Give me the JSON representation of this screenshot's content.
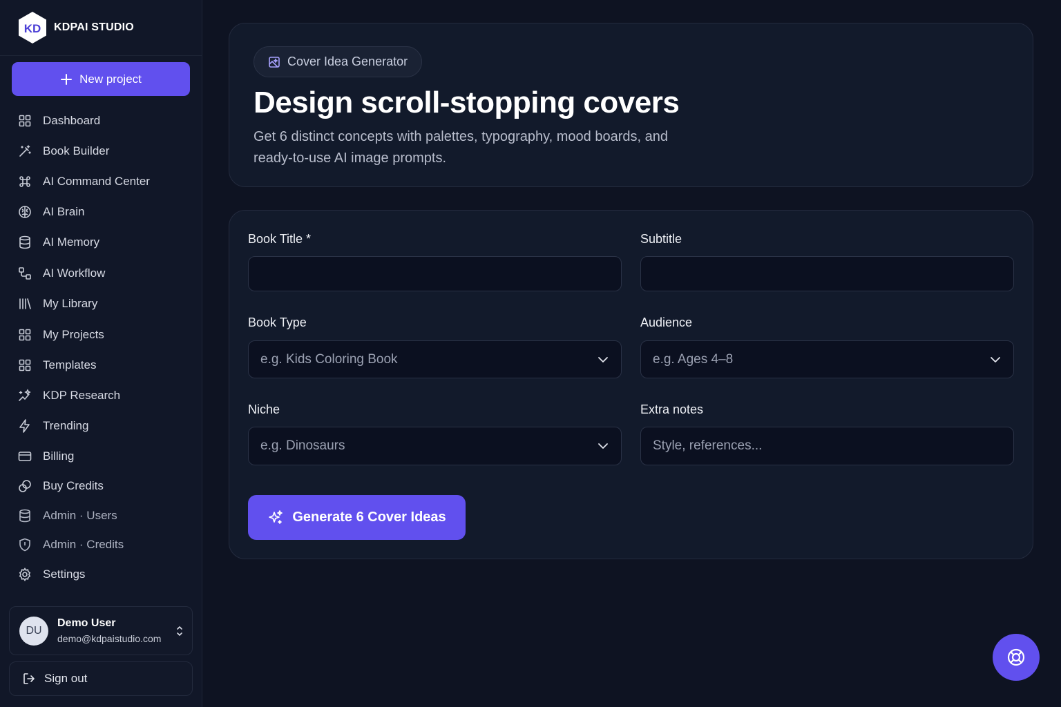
{
  "brand": {
    "name": "KDPAI STUDIO",
    "logo_text": "KD"
  },
  "sidebar": {
    "new_project_label": "New project",
    "items": [
      {
        "label": "Dashboard",
        "icon": "grid-icon"
      },
      {
        "label": "Book Builder",
        "icon": "wand-icon"
      },
      {
        "label": "AI Command Center",
        "icon": "command-icon"
      },
      {
        "label": "AI Brain",
        "icon": "brain-icon"
      },
      {
        "label": "AI Memory",
        "icon": "database-icon"
      },
      {
        "label": "AI Workflow",
        "icon": "workflow-icon"
      },
      {
        "label": "My Library",
        "icon": "library-icon"
      },
      {
        "label": "My Projects",
        "icon": "grid-icon"
      },
      {
        "label": "Templates",
        "icon": "grid-icon"
      },
      {
        "label": "KDP Research",
        "icon": "sparkle-chart-icon"
      },
      {
        "label": "Trending",
        "icon": "bolt-icon"
      },
      {
        "label": "Billing",
        "icon": "card-icon"
      },
      {
        "label": "Buy Credits",
        "icon": "coins-icon"
      },
      {
        "label": "Admin · Users",
        "icon": "database-icon"
      },
      {
        "label": "Admin · Credits",
        "icon": "shield-icon"
      },
      {
        "label": "Settings",
        "icon": "gear-icon"
      }
    ],
    "user": {
      "initials": "DU",
      "name": "Demo User",
      "email": "demo@kdpaistudio.com"
    },
    "sign_out_label": "Sign out"
  },
  "hero": {
    "badge": "Cover Idea Generator",
    "title": "Design scroll-stopping covers",
    "description": "Get 6 distinct concepts with palettes, typography, mood boards, and ready-to-use AI image prompts."
  },
  "form": {
    "book_title": {
      "label": "Book Title *",
      "value": "",
      "placeholder": ""
    },
    "subtitle": {
      "label": "Subtitle",
      "value": "",
      "placeholder": ""
    },
    "book_type": {
      "label": "Book Type",
      "placeholder": "e.g. Kids Coloring Book"
    },
    "audience": {
      "label": "Audience",
      "placeholder": "e.g. Ages 4–8"
    },
    "niche": {
      "label": "Niche",
      "placeholder": "e.g. Dinosaurs"
    },
    "extra_notes": {
      "label": "Extra notes",
      "placeholder": "Style, references..."
    },
    "submit_label": "Generate 6 Cover Ideas"
  },
  "colors": {
    "accent": "#6150ee",
    "background": "#0e1322",
    "panel": "#121a2b"
  }
}
